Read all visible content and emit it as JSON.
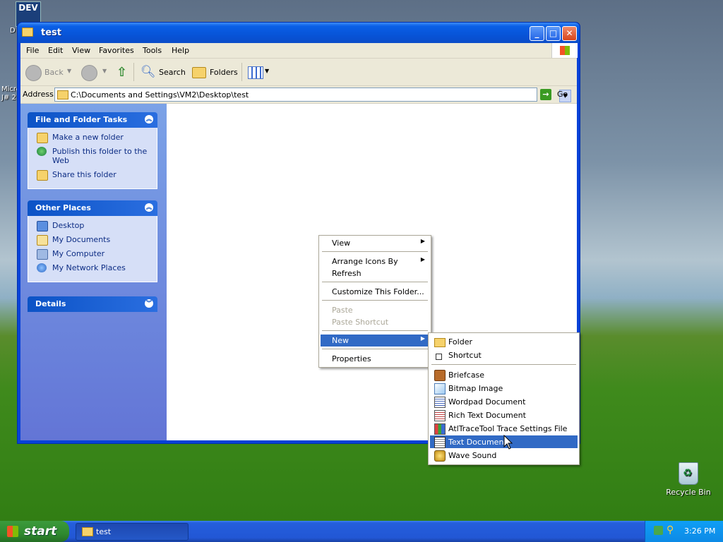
{
  "desktop": {
    "dev_icon_text": "DEV",
    "left_fragments": [
      "D",
      "Micro",
      "J# 2"
    ],
    "recycle_bin_label": "Recycle Bin"
  },
  "window": {
    "title": "test",
    "menu": [
      "File",
      "Edit",
      "View",
      "Favorites",
      "Tools",
      "Help"
    ],
    "toolbar": {
      "back_label": "Back",
      "search_label": "Search",
      "folders_label": "Folders"
    },
    "address": {
      "label": "Address",
      "value": "C:\\Documents and Settings\\VM2\\Desktop\\test",
      "go_label": "Go"
    }
  },
  "left_pane": {
    "groups": [
      {
        "title": "File and Folder Tasks",
        "items": [
          {
            "label": "Make a new folder",
            "icon": "new-folder-icon"
          },
          {
            "label": "Publish this folder to the Web",
            "icon": "globe-icon"
          },
          {
            "label": "Share this folder",
            "icon": "share-folder-icon"
          }
        ]
      },
      {
        "title": "Other Places",
        "items": [
          {
            "label": "Desktop",
            "icon": "desktop-icon"
          },
          {
            "label": "My Documents",
            "icon": "my-documents-icon"
          },
          {
            "label": "My Computer",
            "icon": "my-computer-icon"
          },
          {
            "label": "My Network Places",
            "icon": "network-places-icon"
          }
        ]
      },
      {
        "title": "Details",
        "items": []
      }
    ]
  },
  "context_menu": {
    "items": {
      "view": "View",
      "arrange": "Arrange Icons By",
      "refresh": "Refresh",
      "customize": "Customize This Folder...",
      "paste": "Paste",
      "paste_shortcut": "Paste Shortcut",
      "new": "New",
      "properties": "Properties"
    }
  },
  "new_submenu": {
    "items": {
      "folder": "Folder",
      "shortcut": "Shortcut",
      "briefcase": "Briefcase",
      "bitmap": "Bitmap Image",
      "wordpad": "Wordpad Document",
      "rtf": "Rich Text Document",
      "atltrace": "AtlTraceTool Trace Settings File",
      "text": "Text Document",
      "wave": "Wave Sound"
    },
    "highlighted": "Text Document"
  },
  "taskbar": {
    "start_label": "start",
    "task_label": "test",
    "clock": "3:26 PM"
  }
}
